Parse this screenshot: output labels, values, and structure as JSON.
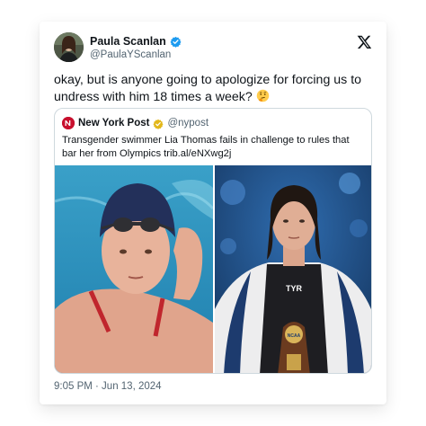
{
  "author": {
    "display_name": "Paula Scanlan",
    "handle": "@PaulaYScanlan",
    "verified_color": "#1d9bf0",
    "avatar_icon": "profile-photo"
  },
  "platform_icon": "x-logo-icon",
  "tweet": {
    "text": "okay, but is anyone going to apologize for forcing us to undress with him 18 times a week?",
    "emoji": "thinking-face-emoji"
  },
  "quoted": {
    "display_name": "New York Post",
    "handle": "@nypost",
    "badge_color": "#e2b719",
    "logo_color": "#c8102e",
    "text": "Transgender swimmer Lia Thomas fails in challenge to rules that bar her from Olympics trib.al/eNXwg2j",
    "images": [
      {
        "name": "swimmer-in-pool-photo"
      },
      {
        "name": "swimmer-with-trophy-photo",
        "shirt_text": "TYR",
        "trophy_text": "NCAA"
      }
    ]
  },
  "timestamp": "9:05 PM · Jun 13, 2024"
}
